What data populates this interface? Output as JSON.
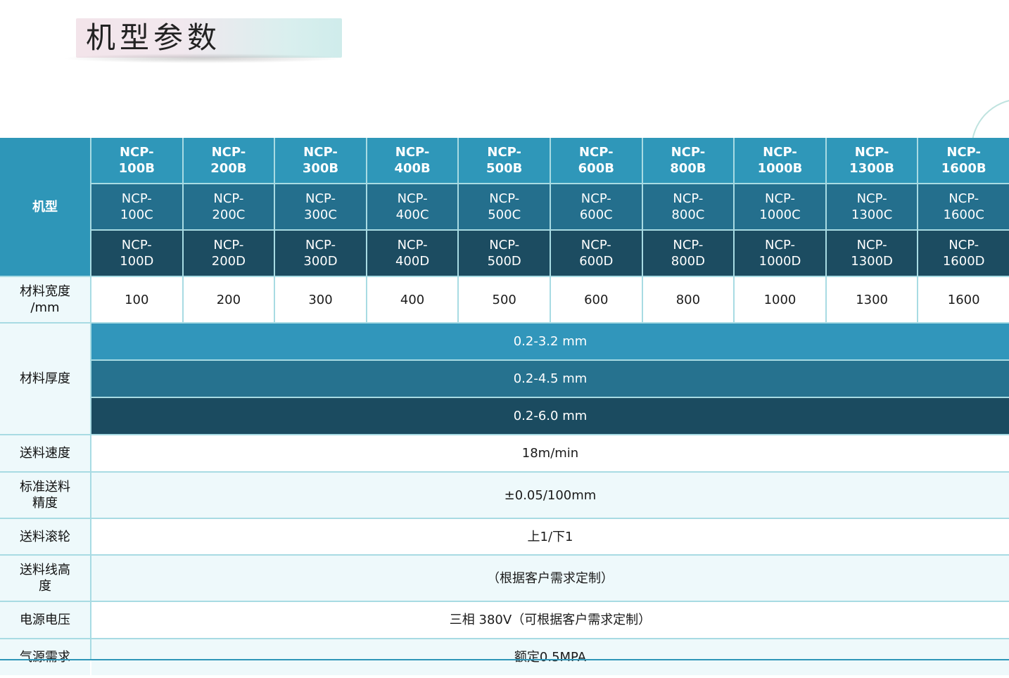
{
  "title": "机型参数",
  "labels": {
    "model": "机型",
    "width": "材料宽度\n/mm",
    "thickness": "材料厚度",
    "speed": "送料速度",
    "accuracy": "标准送料\n精度",
    "roller": "送料滚轮",
    "line_height": "送料线高\n度",
    "voltage": "电源电压",
    "air": "气源需求"
  },
  "models_b": [
    "NCP-\n100B",
    "NCP-\n200B",
    "NCP-\n300B",
    "NCP-\n400B",
    "NCP-\n500B",
    "NCP-\n600B",
    "NCP-\n800B",
    "NCP-\n1000B",
    "NCP-\n1300B",
    "NCP-\n1600B"
  ],
  "models_c": [
    "NCP-\n100C",
    "NCP-\n200C",
    "NCP-\n300C",
    "NCP-\n400C",
    "NCP-\n500C",
    "NCP-\n600C",
    "NCP-\n800C",
    "NCP-\n1000C",
    "NCP-\n1300C",
    "NCP-\n1600C"
  ],
  "models_d": [
    "NCP-\n100D",
    "NCP-\n200D",
    "NCP-\n300D",
    "NCP-\n400D",
    "NCP-\n500D",
    "NCP-\n600D",
    "NCP-\n800D",
    "NCP-\n1000D",
    "NCP-\n1300D",
    "NCP-\n1600D"
  ],
  "widths": [
    "100",
    "200",
    "300",
    "400",
    "500",
    "600",
    "800",
    "1000",
    "1300",
    "1600"
  ],
  "thickness": [
    "0.2-3.2 mm",
    "0.2-4.5 mm",
    "0.2-6.0 mm"
  ],
  "speed": "18m/min",
  "accuracy": "±0.05/100mm",
  "roller": "上1/下1",
  "line_height": "（根据客户需求定制）",
  "voltage": "三相 380V（可根据客户需求定制）",
  "air": "额定0.5MPA",
  "colors": {
    "b_row": "#2f97b9",
    "c_row": "#246f8d",
    "d_row": "#1c4c61",
    "grid_line": "#a8dbe3"
  }
}
